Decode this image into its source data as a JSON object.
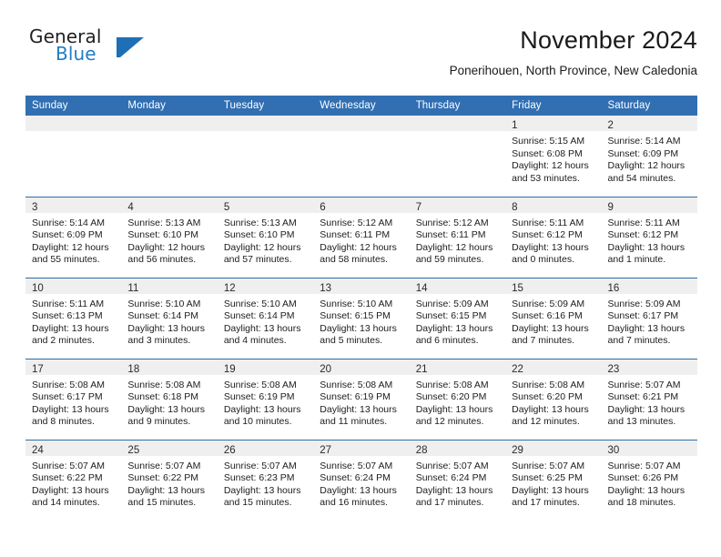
{
  "brand": {
    "name_part1": "General",
    "name_part2": "Blue",
    "mark": "triangle-logo",
    "colors": {
      "blue": "#1f7ec4",
      "dark": "#231f20"
    }
  },
  "header": {
    "month_title": "November 2024",
    "location": "Ponerihouen, North Province, New Caledonia"
  },
  "theme": {
    "header_blue": "#316fb2",
    "row_divider_blue": "#2e6da8",
    "daynum_strip_gray": "#efefef"
  },
  "weekday_headers": [
    "Sunday",
    "Monday",
    "Tuesday",
    "Wednesday",
    "Thursday",
    "Friday",
    "Saturday"
  ],
  "weeks": [
    [
      {
        "day": "",
        "empty": true
      },
      {
        "day": "",
        "empty": true
      },
      {
        "day": "",
        "empty": true
      },
      {
        "day": "",
        "empty": true
      },
      {
        "day": "",
        "empty": true
      },
      {
        "day": "1",
        "sunrise": "Sunrise: 5:15 AM",
        "sunset": "Sunset: 6:08 PM",
        "daylight": "Daylight: 12 hours and 53 minutes."
      },
      {
        "day": "2",
        "sunrise": "Sunrise: 5:14 AM",
        "sunset": "Sunset: 6:09 PM",
        "daylight": "Daylight: 12 hours and 54 minutes."
      }
    ],
    [
      {
        "day": "3",
        "sunrise": "Sunrise: 5:14 AM",
        "sunset": "Sunset: 6:09 PM",
        "daylight": "Daylight: 12 hours and 55 minutes."
      },
      {
        "day": "4",
        "sunrise": "Sunrise: 5:13 AM",
        "sunset": "Sunset: 6:10 PM",
        "daylight": "Daylight: 12 hours and 56 minutes."
      },
      {
        "day": "5",
        "sunrise": "Sunrise: 5:13 AM",
        "sunset": "Sunset: 6:10 PM",
        "daylight": "Daylight: 12 hours and 57 minutes."
      },
      {
        "day": "6",
        "sunrise": "Sunrise: 5:12 AM",
        "sunset": "Sunset: 6:11 PM",
        "daylight": "Daylight: 12 hours and 58 minutes."
      },
      {
        "day": "7",
        "sunrise": "Sunrise: 5:12 AM",
        "sunset": "Sunset: 6:11 PM",
        "daylight": "Daylight: 12 hours and 59 minutes."
      },
      {
        "day": "8",
        "sunrise": "Sunrise: 5:11 AM",
        "sunset": "Sunset: 6:12 PM",
        "daylight": "Daylight: 13 hours and 0 minutes."
      },
      {
        "day": "9",
        "sunrise": "Sunrise: 5:11 AM",
        "sunset": "Sunset: 6:12 PM",
        "daylight": "Daylight: 13 hours and 1 minute."
      }
    ],
    [
      {
        "day": "10",
        "sunrise": "Sunrise: 5:11 AM",
        "sunset": "Sunset: 6:13 PM",
        "daylight": "Daylight: 13 hours and 2 minutes."
      },
      {
        "day": "11",
        "sunrise": "Sunrise: 5:10 AM",
        "sunset": "Sunset: 6:14 PM",
        "daylight": "Daylight: 13 hours and 3 minutes."
      },
      {
        "day": "12",
        "sunrise": "Sunrise: 5:10 AM",
        "sunset": "Sunset: 6:14 PM",
        "daylight": "Daylight: 13 hours and 4 minutes."
      },
      {
        "day": "13",
        "sunrise": "Sunrise: 5:10 AM",
        "sunset": "Sunset: 6:15 PM",
        "daylight": "Daylight: 13 hours and 5 minutes."
      },
      {
        "day": "14",
        "sunrise": "Sunrise: 5:09 AM",
        "sunset": "Sunset: 6:15 PM",
        "daylight": "Daylight: 13 hours and 6 minutes."
      },
      {
        "day": "15",
        "sunrise": "Sunrise: 5:09 AM",
        "sunset": "Sunset: 6:16 PM",
        "daylight": "Daylight: 13 hours and 7 minutes."
      },
      {
        "day": "16",
        "sunrise": "Sunrise: 5:09 AM",
        "sunset": "Sunset: 6:17 PM",
        "daylight": "Daylight: 13 hours and 7 minutes."
      }
    ],
    [
      {
        "day": "17",
        "sunrise": "Sunrise: 5:08 AM",
        "sunset": "Sunset: 6:17 PM",
        "daylight": "Daylight: 13 hours and 8 minutes."
      },
      {
        "day": "18",
        "sunrise": "Sunrise: 5:08 AM",
        "sunset": "Sunset: 6:18 PM",
        "daylight": "Daylight: 13 hours and 9 minutes."
      },
      {
        "day": "19",
        "sunrise": "Sunrise: 5:08 AM",
        "sunset": "Sunset: 6:19 PM",
        "daylight": "Daylight: 13 hours and 10 minutes."
      },
      {
        "day": "20",
        "sunrise": "Sunrise: 5:08 AM",
        "sunset": "Sunset: 6:19 PM",
        "daylight": "Daylight: 13 hours and 11 minutes."
      },
      {
        "day": "21",
        "sunrise": "Sunrise: 5:08 AM",
        "sunset": "Sunset: 6:20 PM",
        "daylight": "Daylight: 13 hours and 12 minutes."
      },
      {
        "day": "22",
        "sunrise": "Sunrise: 5:08 AM",
        "sunset": "Sunset: 6:20 PM",
        "daylight": "Daylight: 13 hours and 12 minutes."
      },
      {
        "day": "23",
        "sunrise": "Sunrise: 5:07 AM",
        "sunset": "Sunset: 6:21 PM",
        "daylight": "Daylight: 13 hours and 13 minutes."
      }
    ],
    [
      {
        "day": "24",
        "sunrise": "Sunrise: 5:07 AM",
        "sunset": "Sunset: 6:22 PM",
        "daylight": "Daylight: 13 hours and 14 minutes."
      },
      {
        "day": "25",
        "sunrise": "Sunrise: 5:07 AM",
        "sunset": "Sunset: 6:22 PM",
        "daylight": "Daylight: 13 hours and 15 minutes."
      },
      {
        "day": "26",
        "sunrise": "Sunrise: 5:07 AM",
        "sunset": "Sunset: 6:23 PM",
        "daylight": "Daylight: 13 hours and 15 minutes."
      },
      {
        "day": "27",
        "sunrise": "Sunrise: 5:07 AM",
        "sunset": "Sunset: 6:24 PM",
        "daylight": "Daylight: 13 hours and 16 minutes."
      },
      {
        "day": "28",
        "sunrise": "Sunrise: 5:07 AM",
        "sunset": "Sunset: 6:24 PM",
        "daylight": "Daylight: 13 hours and 17 minutes."
      },
      {
        "day": "29",
        "sunrise": "Sunrise: 5:07 AM",
        "sunset": "Sunset: 6:25 PM",
        "daylight": "Daylight: 13 hours and 17 minutes."
      },
      {
        "day": "30",
        "sunrise": "Sunrise: 5:07 AM",
        "sunset": "Sunset: 6:26 PM",
        "daylight": "Daylight: 13 hours and 18 minutes."
      }
    ]
  ]
}
